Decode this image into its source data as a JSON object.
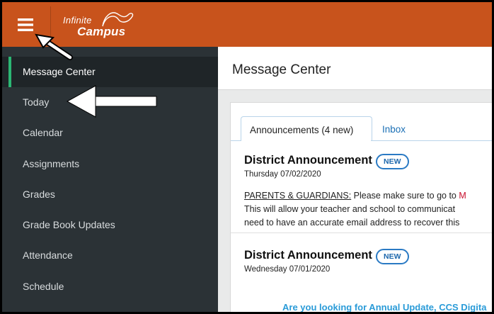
{
  "brand": {
    "line1": "Infinite",
    "line2": "Campus",
    "topbar_color": "#c8531c"
  },
  "sidebar": {
    "items": [
      {
        "label": "Message Center",
        "active": true
      },
      {
        "label": "Today"
      },
      {
        "label": "Calendar"
      },
      {
        "label": "Assignments"
      },
      {
        "label": "Grades"
      },
      {
        "label": "Grade Book Updates"
      },
      {
        "label": "Attendance"
      },
      {
        "label": "Schedule"
      }
    ]
  },
  "main": {
    "title": "Message Center",
    "tabs": [
      {
        "label": "Announcements (4 new)",
        "active": true
      },
      {
        "label": "Inbox"
      }
    ],
    "announcements": [
      {
        "title": "District Announcement",
        "badge": "NEW",
        "date": "Thursday 07/02/2020",
        "body_heading": "PARENTS & GUARDIANS:",
        "body_line1": " Please make sure to go to ",
        "body_red": "M",
        "body_line2": "This will allow your teacher and school to communicat",
        "body_line3": "need to have an accurate email address to recover this"
      },
      {
        "title": "District Announcement",
        "badge": "NEW",
        "date": "Wednesday 07/01/2020",
        "link_text": "Are you looking for Annual Update, CCS Digita"
      }
    ]
  }
}
